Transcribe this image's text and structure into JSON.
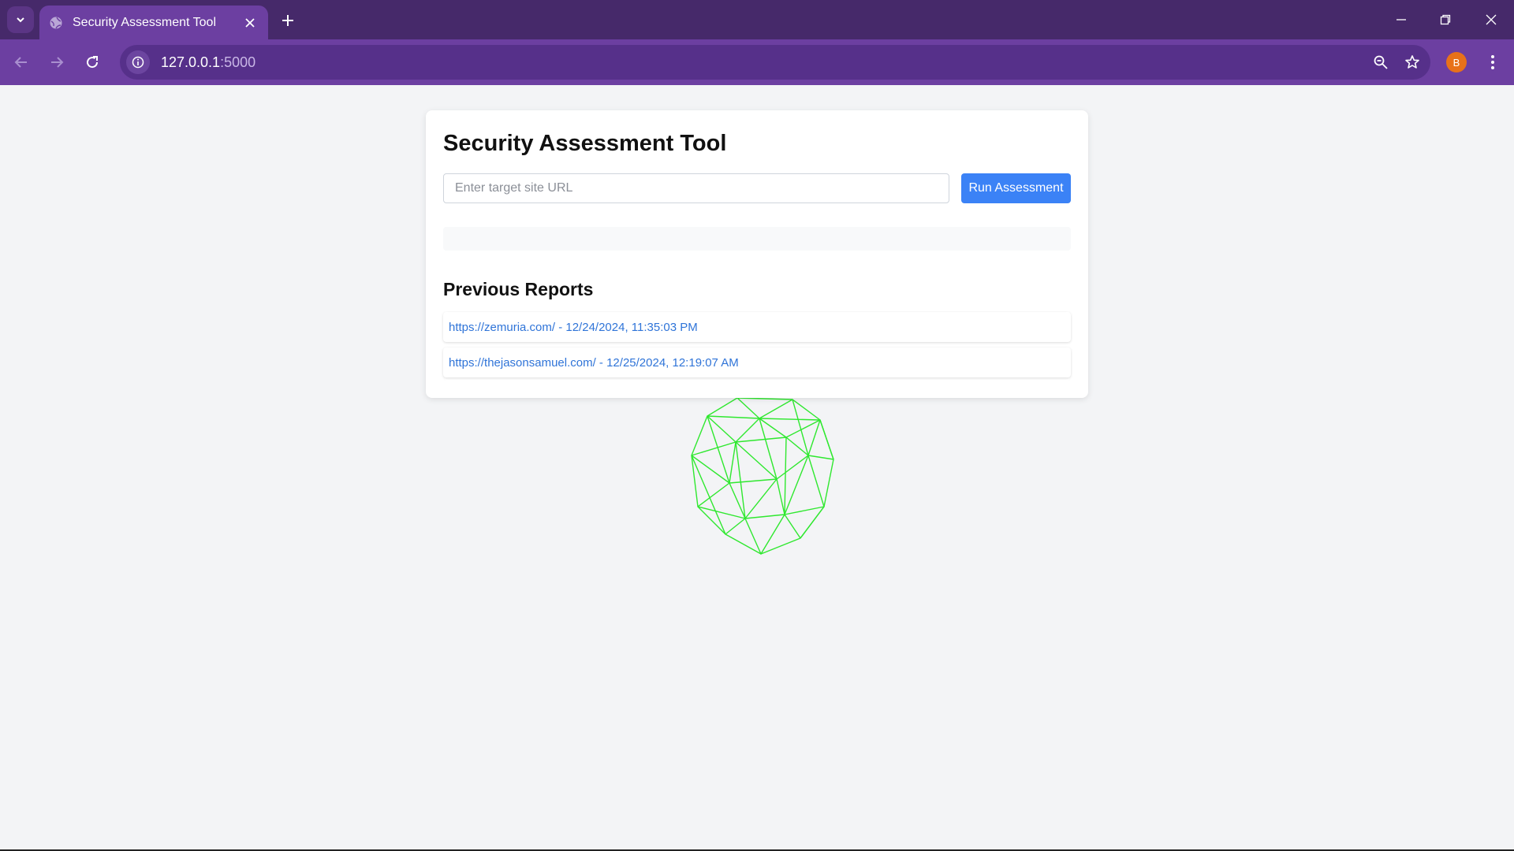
{
  "browser": {
    "tab_title": "Security Assessment Tool",
    "url_host": "127.0.0.1",
    "url_port": ":5000",
    "profile_initial": "B",
    "icons": {
      "tab_search": "chevron-down-icon",
      "favicon": "globe-icon",
      "tab_close": "close-icon",
      "new_tab": "plus-icon",
      "back": "arrow-left-icon",
      "forward": "arrow-right-icon",
      "reload": "reload-icon",
      "site_info": "info-icon",
      "zoom": "zoom-out-icon",
      "bookmark": "star-icon",
      "menu": "kebab-menu-icon"
    },
    "colors": {
      "tabstrip": "#46296a",
      "toolbar": "#6c3fa1",
      "avatar": "#e8711a"
    }
  },
  "page": {
    "title": "Security Assessment Tool",
    "url_input_placeholder": "Enter target site URL",
    "url_input_value": "",
    "run_button": "Run Assessment",
    "reports_heading": "Previous Reports",
    "reports": [
      {
        "label": "https://zemuria.com/ - 12/24/2024, 11:35:03 PM"
      },
      {
        "label": "https://thejasonsamuel.com/ - 12/25/2024, 12:19:07 AM"
      }
    ],
    "colors": {
      "button": "#3b82f6",
      "link": "#2f74d8",
      "wireframe": "#2fe82f"
    }
  }
}
